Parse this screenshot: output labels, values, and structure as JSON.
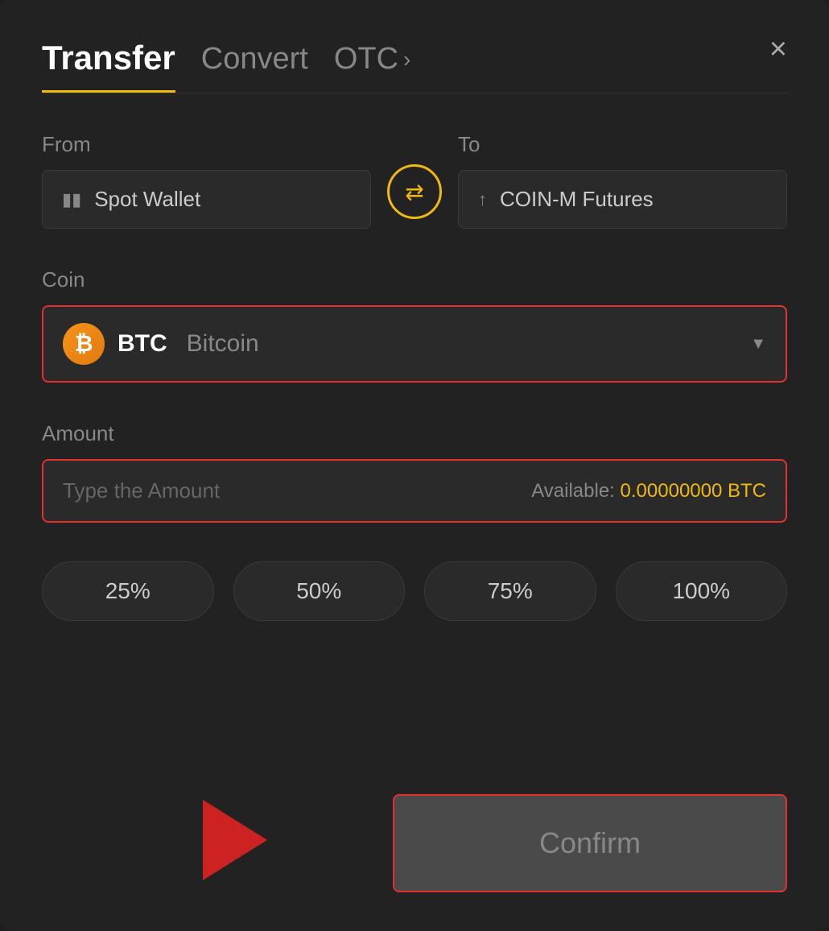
{
  "header": {
    "tab_transfer": "Transfer",
    "tab_convert": "Convert",
    "tab_otc": "OTC",
    "close_label": "×"
  },
  "from_field": {
    "label": "From",
    "wallet_name": "Spot Wallet",
    "wallet_icon": "💳"
  },
  "to_field": {
    "label": "To",
    "wallet_name": "COIN-M Futures",
    "wallet_icon": "↑"
  },
  "coin_field": {
    "label": "Coin",
    "symbol": "BTC",
    "name": "Bitcoin"
  },
  "amount_field": {
    "label": "Amount",
    "placeholder": "Type the Amount",
    "available_label": "Available:",
    "available_value": "0.00000000 BTC"
  },
  "pct_buttons": [
    "25%",
    "50%",
    "75%",
    "100%"
  ],
  "confirm_button": {
    "label": "Confirm"
  }
}
